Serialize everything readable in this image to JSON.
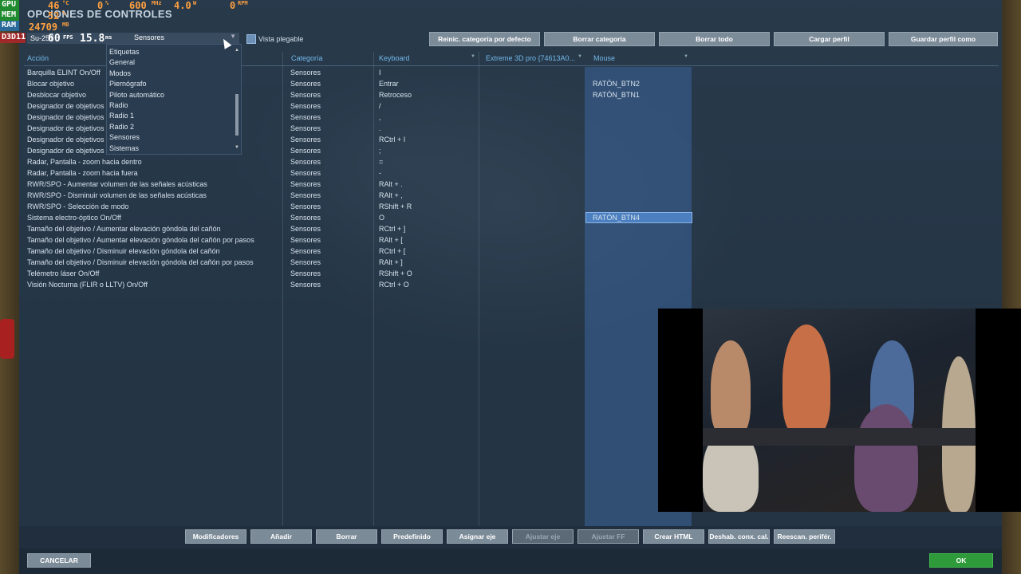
{
  "hud": {
    "gpu_label": "GPU",
    "mem_label": "MEM",
    "ram_label": "RAM",
    "d3d_label": "D3D11",
    "gpu_temp": "46",
    "gpu_temp_unit": "°C",
    "gpu_load": "0",
    "gpu_load_unit": "%",
    "gpu_clock": "600",
    "gpu_clock_unit": "MHz",
    "gpu_power": "4.0",
    "gpu_power_unit": "W",
    "gpu_fan": "0",
    "gpu_fan_unit": "RPM",
    "mem_val": "52",
    "mem_unit": "%",
    "ram_val": "24709",
    "ram_unit": "MB",
    "fps": "60",
    "fps_unit": "FPS",
    "frametime": "15.8",
    "frametime_unit": "ms"
  },
  "window": {
    "title": "OPCIONES DE CONTROLES"
  },
  "aircraft": "Su-25T",
  "category_select": {
    "value": "Sensores"
  },
  "foldable_view": {
    "label": "Vista plegable"
  },
  "top_buttons": [
    "Reinic. categoría por defecto",
    "Borrar categoría",
    "Borrar todo",
    "Cargar perfil",
    "Guardar perfil como"
  ],
  "columns": {
    "action": "Acción",
    "category": "Categoría",
    "keyboard": "Keyboard",
    "joystick": "Extreme 3D pro {74613A0...",
    "mouse": "Mouse"
  },
  "dropdown_options": [
    "Etiquetas",
    "General",
    "Modos",
    "Piernógrafo",
    "Piloto automático",
    "Radio",
    "Radio 1",
    "Radio 2",
    "Sensores",
    "Sistemas"
  ],
  "rows": [
    {
      "action": "Barquilla ELINT On/Off",
      "category": "Sensores",
      "keyboard": "I",
      "mouse": ""
    },
    {
      "action": "Blocar objetivo",
      "category": "Sensores",
      "keyboard": "Entrar",
      "mouse": "RATÓN_BTN2"
    },
    {
      "action": "Desblocar objetivo",
      "category": "Sensores",
      "keyboard": "Retroceso",
      "mouse": "RATÓN_BTN1"
    },
    {
      "action": "Designador de objetivos a",
      "category": "Sensores",
      "keyboard": "/",
      "mouse": ""
    },
    {
      "action": "Designador de objetivos a",
      "category": "Sensores",
      "keyboard": ",",
      "mouse": ""
    },
    {
      "action": "Designador de objetivos a",
      "category": "Sensores",
      "keyboard": ".",
      "mouse": ""
    },
    {
      "action": "Designador de objetivos a",
      "category": "Sensores",
      "keyboard": "RCtrl + I",
      "mouse": ""
    },
    {
      "action": "Designador de objetivos a",
      "category": "Sensores",
      "keyboard": ";",
      "mouse": ""
    },
    {
      "action": "Radar, Pantalla - zoom hacia dentro",
      "category": "Sensores",
      "keyboard": "=",
      "mouse": ""
    },
    {
      "action": "Radar, Pantalla - zoom hacia fuera",
      "category": "Sensores",
      "keyboard": "-",
      "mouse": ""
    },
    {
      "action": "RWR/SPO - Aumentar volumen de las señales acústicas",
      "category": "Sensores",
      "keyboard": "RAlt + .",
      "mouse": ""
    },
    {
      "action": "RWR/SPO - Disminuir volumen de las señales acústicas",
      "category": "Sensores",
      "keyboard": "RAlt + ,",
      "mouse": ""
    },
    {
      "action": "RWR/SPO - Selección de modo",
      "category": "Sensores",
      "keyboard": "RShift + R",
      "mouse": ""
    },
    {
      "action": "Sistema electro-óptico On/Off",
      "category": "Sensores",
      "keyboard": "O",
      "mouse": "RATÓN_BTN4",
      "selected": true
    },
    {
      "action": "Tamaño del objetivo / Aumentar elevación góndola del cañón",
      "category": "Sensores",
      "keyboard": "RCtrl + ]",
      "mouse": ""
    },
    {
      "action": "Tamaño del objetivo / Aumentar elevación góndola del cañón por pasos",
      "category": "Sensores",
      "keyboard": "RAlt + [",
      "mouse": ""
    },
    {
      "action": "Tamaño del objetivo / Disminuir elevación góndola del cañón",
      "category": "Sensores",
      "keyboard": "RCtrl + [",
      "mouse": ""
    },
    {
      "action": "Tamaño del objetivo / Disminuir elevación góndola del cañón por pasos",
      "category": "Sensores",
      "keyboard": "RAlt + ]",
      "mouse": ""
    },
    {
      "action": "Telémetro láser On/Off",
      "category": "Sensores",
      "keyboard": "RShift + O",
      "mouse": ""
    },
    {
      "action": "Visión Nocturna (FLIR o LLTV) On/Off",
      "category": "Sensores",
      "keyboard": "RCtrl + O",
      "mouse": ""
    }
  ],
  "bottom_buttons": [
    {
      "label": "Modificadores",
      "enabled": true
    },
    {
      "label": "Añadir",
      "enabled": true
    },
    {
      "label": "Borrar",
      "enabled": true
    },
    {
      "label": "Predefinido",
      "enabled": true
    },
    {
      "label": "Asignar eje",
      "enabled": true
    },
    {
      "label": "Ajustar eje",
      "enabled": false
    },
    {
      "label": "Ajustar FF",
      "enabled": false
    },
    {
      "label": "Crear HTML",
      "enabled": true
    },
    {
      "label": "Deshab. conx. cal.",
      "enabled": true
    },
    {
      "label": "Reescan. perifér.",
      "enabled": true
    }
  ],
  "cancel_label": "CANCELAR",
  "ok_label": "OK",
  "colors": {
    "ok_green": "#2e9a3a",
    "selection_blue": "#4b7fbf",
    "header_blue": "#72b8e8",
    "hud_orange": "#ffa040"
  }
}
